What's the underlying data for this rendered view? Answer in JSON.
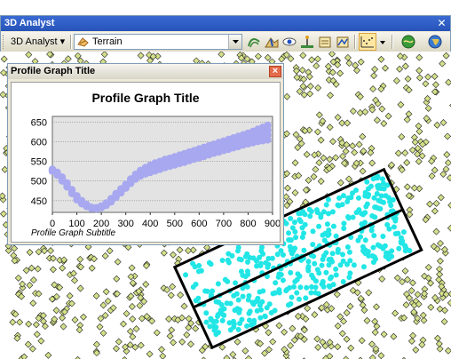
{
  "toolbar": {
    "title": "3D Analyst",
    "menu_label": "3D Analyst",
    "layer_value": "Terrain",
    "icons": [
      "contour-icon",
      "steepest-path-icon",
      "line-of-sight-icon",
      "interpolate-point-icon",
      "interpolate-line-icon",
      "interpolate-polygon-icon",
      "profile-graph-icon",
      "arcscene-icon",
      "arcglobe-icon"
    ]
  },
  "graph_window": {
    "title": "Profile Graph Title",
    "close": "×"
  },
  "chart_data": {
    "type": "scatter",
    "title": "Profile Graph Title",
    "subtitle": "Profile Graph Subtitle",
    "xlabel": "",
    "ylabel": "",
    "xlim": [
      0,
      900
    ],
    "ylim": [
      420,
      665
    ],
    "x_ticks": [
      0,
      100,
      200,
      300,
      400,
      500,
      600,
      700,
      800,
      900
    ],
    "y_ticks": [
      450,
      500,
      550,
      600,
      650
    ],
    "grid": true,
    "color": "#a8a8f0",
    "series": [
      {
        "x": [
          0,
          20,
          40,
          60,
          80,
          100,
          120,
          140,
          160,
          180,
          200,
          220,
          240,
          260,
          280,
          300,
          320,
          340,
          360,
          380,
          400,
          420,
          440,
          460,
          480,
          500,
          520,
          540,
          560,
          580,
          600,
          620,
          640,
          660,
          680,
          700,
          720,
          740,
          760,
          780,
          800,
          820,
          840,
          860,
          880
        ],
        "y": [
          530,
          522,
          510,
          495,
          478,
          462,
          450,
          440,
          433,
          432,
          436,
          444,
          455,
          468,
          480,
          492,
          505,
          517,
          527,
          534,
          540,
          546,
          550,
          555,
          558,
          562,
          566,
          570,
          574,
          578,
          582,
          586,
          590,
          594,
          598,
          602,
          606,
          610,
          614,
          618,
          622,
          627,
          632,
          637,
          642
        ],
        "y_low": [
          525,
          515,
          500,
          485,
          468,
          452,
          442,
          435,
          430,
          429,
          432,
          438,
          447,
          458,
          470,
          482,
          494,
          505,
          513,
          518,
          522,
          526,
          530,
          534,
          538,
          541,
          545,
          548,
          552,
          556,
          559,
          563,
          567,
          571,
          574,
          578,
          581,
          585,
          588,
          592,
          595,
          598,
          601,
          603,
          605
        ]
      }
    ]
  }
}
